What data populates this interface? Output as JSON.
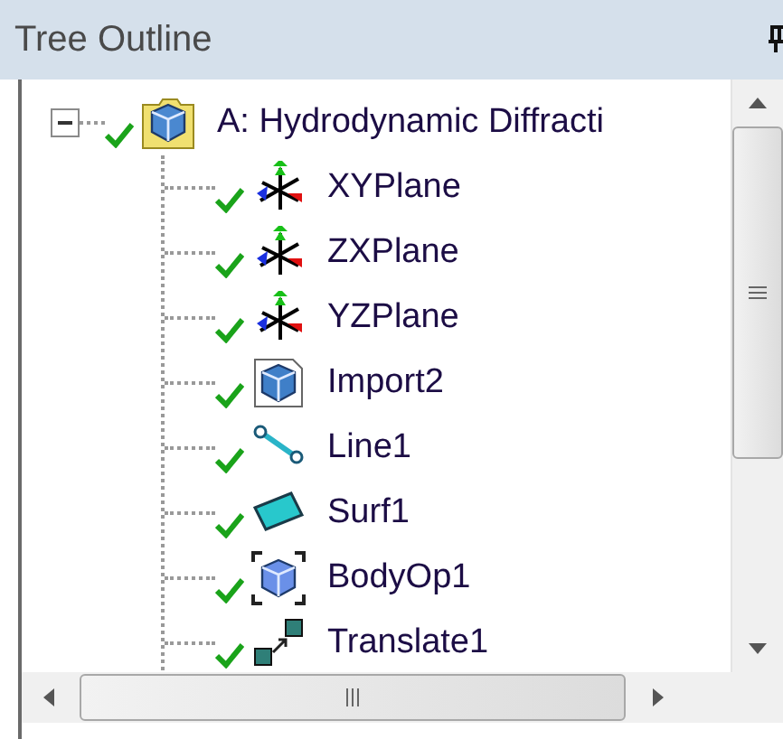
{
  "panel": {
    "title": "Tree Outline"
  },
  "tree": {
    "label": "A: Hydrodynamic Diffracti",
    "expanded": true,
    "children": [
      {
        "label": "XYPlane",
        "kind": "plane"
      },
      {
        "label": "ZXPlane",
        "kind": "plane"
      },
      {
        "label": "YZPlane",
        "kind": "plane"
      },
      {
        "label": "Import2",
        "kind": "import"
      },
      {
        "label": "Line1",
        "kind": "line"
      },
      {
        "label": "Surf1",
        "kind": "surface"
      },
      {
        "label": "BodyOp1",
        "kind": "bodyop"
      },
      {
        "label": "Translate1",
        "kind": "translate"
      }
    ]
  }
}
